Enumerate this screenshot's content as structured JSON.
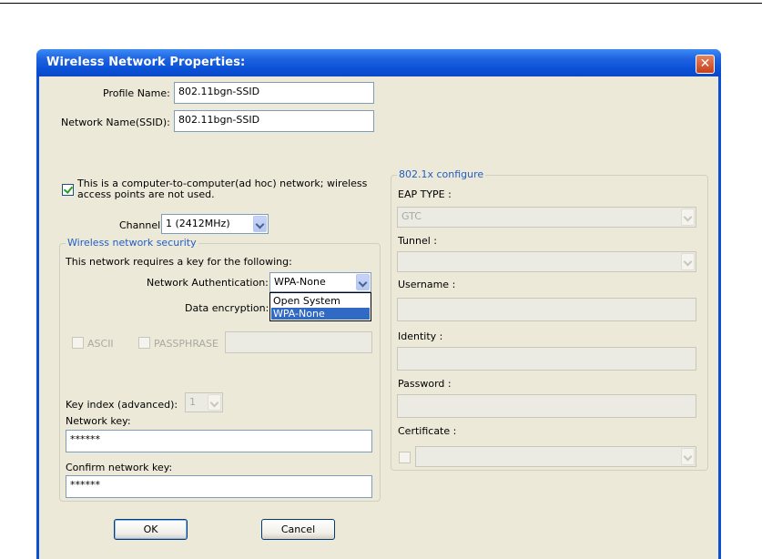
{
  "window": {
    "title": "Wireless Network Properties:",
    "close_glyph": "✕"
  },
  "profile": {
    "label": "Profile Name:",
    "value": "802.11bgn-SSID"
  },
  "ssid": {
    "label": "Network Name(SSID):",
    "value": "802.11bgn-SSID"
  },
  "adhoc": {
    "checked": true,
    "line1": "This is a computer-to-computer(ad hoc) network; wireless",
    "line2": "access points are not used."
  },
  "channel": {
    "label": "Channel:",
    "value": "1  (2412MHz)"
  },
  "security": {
    "group_title": "Wireless network security",
    "requires_text": "This network requires a key for the following:",
    "auth_label": "Network Authentication:",
    "auth_value": "WPA-None",
    "auth_options": [
      "Open System",
      "WPA-None"
    ],
    "auth_selected_option": "WPA-None",
    "enc_label": "Data encryption:",
    "ascii_label": "ASCII",
    "passphrase_label": "PASSPHRASE",
    "key_index_label": "Key index (advanced):",
    "key_index_value": "1",
    "network_key_label": "Network key:",
    "network_key_value": "******",
    "confirm_key_label": "Confirm network key:",
    "confirm_key_value": "******"
  },
  "eap": {
    "group_title": "802.1x configure",
    "eap_type_label": "EAP TYPE :",
    "eap_type_value": "GTC",
    "tunnel_label": "Tunnel :",
    "username_label": "Username :",
    "identity_label": "Identity :",
    "password_label": "Password :",
    "certificate_label": "Certificate :"
  },
  "buttons": {
    "ok": "OK",
    "cancel": "Cancel"
  },
  "colors": {
    "title_bar": "#0a52d8",
    "dialog_bg": "#ece9d8",
    "group_title": "#215dc6",
    "selection": "#316ac5"
  }
}
